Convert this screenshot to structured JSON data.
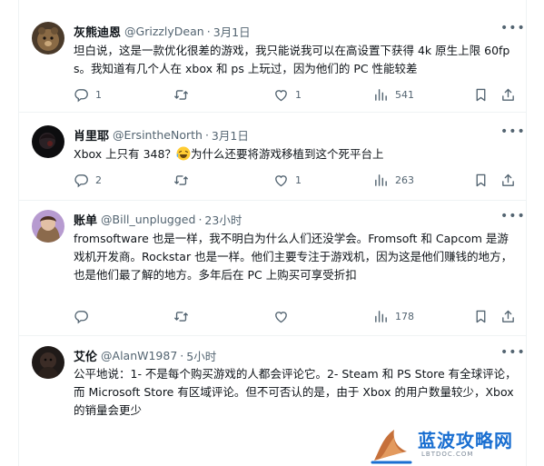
{
  "tweets": [
    {
      "name": "灰熊迪恩",
      "handle": "@GrizzlyDean",
      "dot": "·",
      "time": "3月1日",
      "text": "坦白说，这是一款优化很差的游戏，我只能说我可以在高设置下获得 4k 原生上限 60fps。我知道有几个人在 xbox 和 ps 上玩过，因为他们的 PC 性能较差",
      "replies": "1",
      "retweets": "",
      "likes": "1",
      "views": "541"
    },
    {
      "name": "肖里耶",
      "handle": "@ErsintheNorth",
      "dot": "·",
      "time": "3月1日",
      "text_before": "Xbox 上只有 348？",
      "text_after": "为什么还要将游戏移植到这个死平台上",
      "replies": "2",
      "retweets": "",
      "likes": "1",
      "views": "263"
    },
    {
      "name": "账单",
      "handle": "@Bill_unplugged",
      "dot": "·",
      "time": "23小时",
      "text": "fromsoftware 也是一样，我不明白为什么人们还没学会。Fromsoft 和 Capcom 是游戏机开发商。Rockstar 也是一样。他们主要专注于游戏机，因为这是他们赚钱的地方，也是他们最了解的地方。多年后在 PC 上购买可享受折扣",
      "replies": "",
      "retweets": "",
      "likes": "",
      "views": "178"
    },
    {
      "name": "艾伦",
      "handle": "@AlanW1987",
      "dot": "·",
      "time": "5小时",
      "text": "公平地说：1- 不是每个购买游戏的人都会评论它。2- Steam 和 PS Store 有全球评论，而 Microsoft Store 有区域评论。但不可否认的是，由于 Xbox 的用户数量较少，Xbox 的销量会更少"
    }
  ],
  "watermark": {
    "title": "蓝波攻略网",
    "url": "LBTDOC.COM"
  },
  "colors": {
    "text": "#0f1419",
    "secondary": "#536471",
    "divider": "#eff3f4",
    "watermark": "#1a6fd1"
  },
  "icons": [
    "reply-icon",
    "retweet-icon",
    "like-icon",
    "views-icon",
    "bookmark-icon",
    "share-icon",
    "more-icon",
    "laughing-emoji"
  ]
}
